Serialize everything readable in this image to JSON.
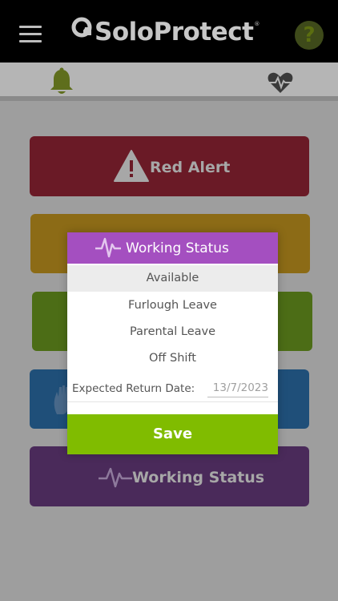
{
  "header": {
    "brand_name": "SoloProtect",
    "brand_reg": "®",
    "help_label": "?"
  },
  "subbar": {
    "icons": [
      "bell-icon",
      "heart-pulse-icon"
    ]
  },
  "main": {
    "red_alert_label": "Red Alert",
    "working_status_label": "Working Status"
  },
  "modal": {
    "title": "Working Status",
    "options": [
      "Available",
      "Furlough Leave",
      "Parental Leave",
      "Off Shift"
    ],
    "selected": "Available",
    "return_label": "Expected Return Date:",
    "return_date": "13/7/2023",
    "save_label": "Save"
  },
  "colors": {
    "modal_header": "#a44fc0",
    "save_button": "#80bc00",
    "red_alert": "#6a1a26",
    "working_status": "#4a2a5a"
  }
}
